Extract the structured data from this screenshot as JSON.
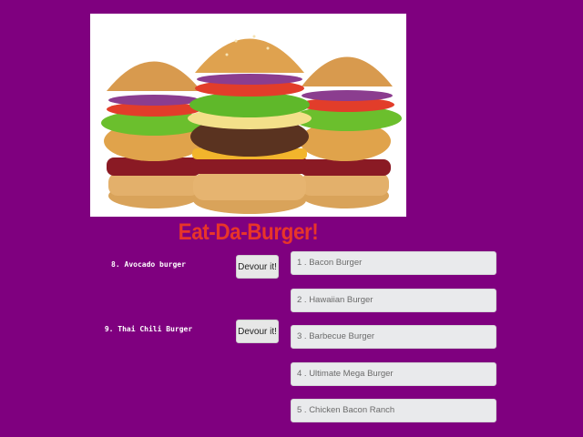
{
  "app": {
    "title": "Eat-Da-Burger!",
    "hero_image": "burgers-photo"
  },
  "colors": {
    "background": "#7f007f",
    "title": "#e8352a",
    "button_bg": "#e7e7e7",
    "list_bg": "#e9eaec"
  },
  "uneaten": [
    {
      "label": "8. Avocado burger",
      "button": "Devour it!"
    },
    {
      "label": "9. Thai Chili Burger",
      "button": "Devour it!"
    }
  ],
  "devoured": [
    {
      "label": "1 . Bacon Burger"
    },
    {
      "label": "2 . Hawaiian Burger"
    },
    {
      "label": "3 . Barbecue Burger"
    },
    {
      "label": "4 . Ultimate Mega Burger"
    },
    {
      "label": "5 . Chicken Bacon Ranch"
    }
  ]
}
